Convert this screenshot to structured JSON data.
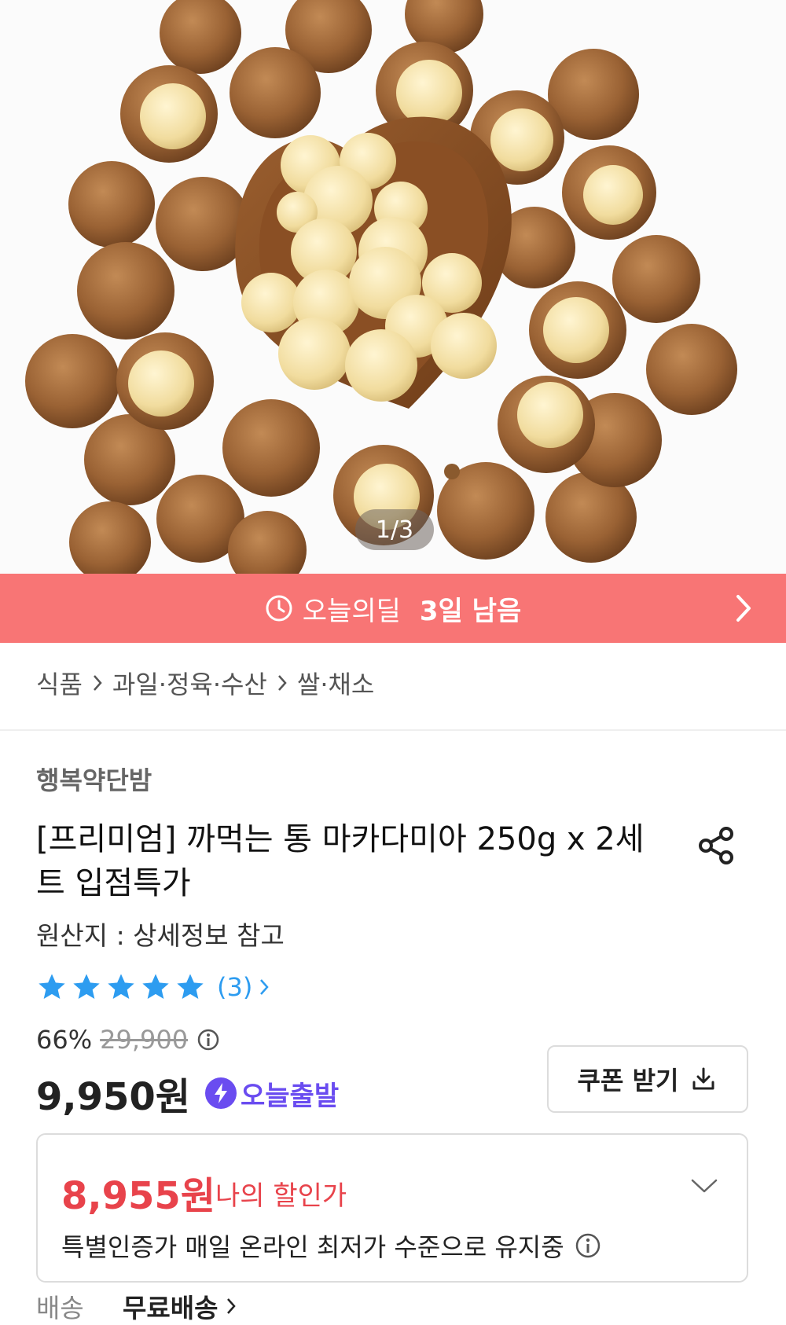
{
  "gallery": {
    "pager": "1/3"
  },
  "deal": {
    "label": "오늘의딜",
    "remaining": "3일 남음"
  },
  "breadcrumb": [
    "식품",
    "과일·정육·수산",
    "쌀·채소"
  ],
  "product": {
    "seller": "행복약단밤",
    "title": "[프리미엄] 까먹는 통 마카다미아 250g x 2세트 입점특가",
    "origin": "원산지 : 상세정보 참고",
    "rating": 5,
    "review_count": "(3)",
    "discount": "66%",
    "original_price": "29,900",
    "price": "9,950원",
    "delivery_badge": "오늘출발",
    "coupon_label": "쿠폰 받기"
  },
  "my_price": {
    "price": "8,955원",
    "label": "나의 할인가",
    "note": "특별인증가 매일 온라인 최저가 수준으로 유지중"
  },
  "shipping": {
    "label": "배송",
    "value": "무료배송"
  },
  "colors": {
    "deal": "#f87575",
    "star": "#2d9cf0",
    "my_price": "#e8434b",
    "badge": "#6a4cf0"
  }
}
